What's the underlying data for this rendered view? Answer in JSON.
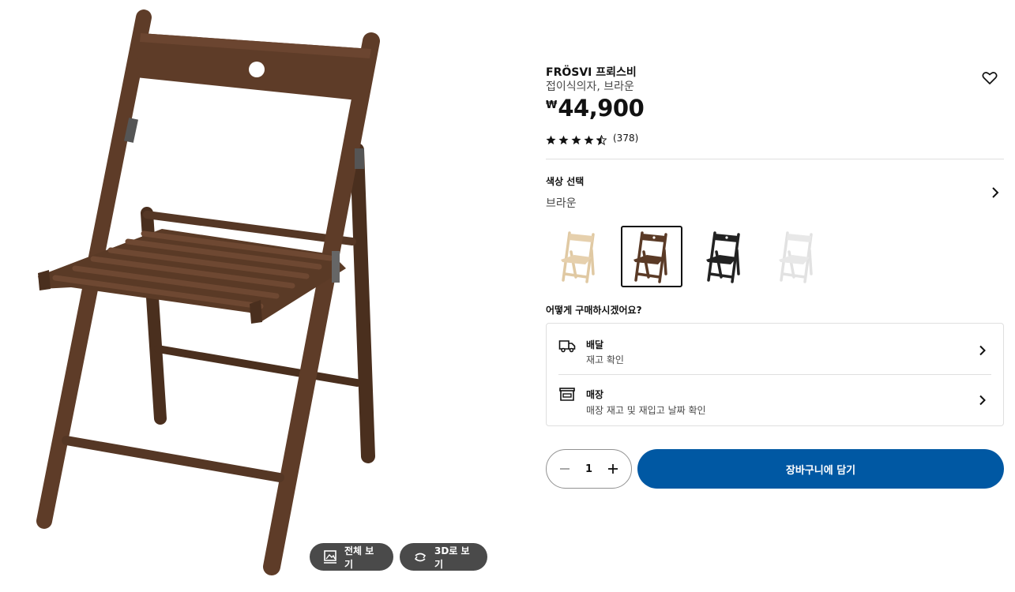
{
  "gallery": {
    "view_all_label": "전체 보기",
    "view_3d_label": "3D로 보기"
  },
  "product": {
    "name": "FRÖSVI 프뢰스비",
    "description": "접이식의자, 브라운",
    "currency": "₩",
    "price": "44,900",
    "rating_value": 4.5,
    "rating_max": 5,
    "review_count": "(378)"
  },
  "color_section": {
    "label": "색상 선택",
    "selected_color": "브라운",
    "swatches": [
      {
        "name": "birch",
        "color": "#e6d0ad"
      },
      {
        "name": "brown",
        "color": "#5a3a26",
        "selected": true
      },
      {
        "name": "black",
        "color": "#222222"
      },
      {
        "name": "white",
        "color": "#e2e2e2"
      }
    ]
  },
  "purchase": {
    "heading": "어떻게 구매하시겠어요?",
    "delivery_title": "배달",
    "delivery_sub": "재고 확인",
    "store_title": "매장",
    "store_sub": "매장 재고 및 재입고 날짜 확인"
  },
  "cart": {
    "quantity": "1",
    "add_label": "장바구니에 담기"
  },
  "colors": {
    "accent": "#0058a3",
    "gallery_button": "#4a4a4a",
    "chair_wood": "#5a3a26"
  }
}
